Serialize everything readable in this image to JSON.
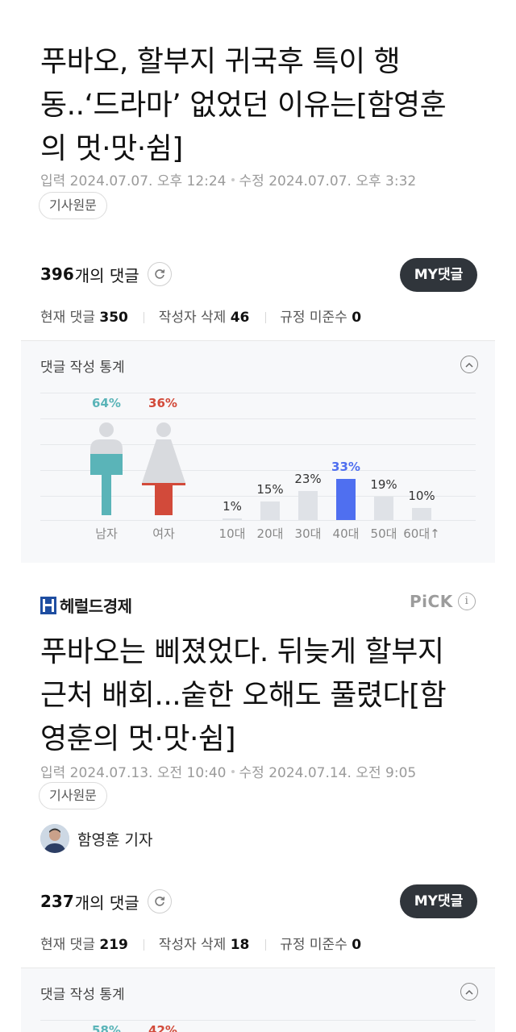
{
  "article1": {
    "title_lines": [
      "푸바오, 할부지 귀국후 특이 행",
      "동..‘드라마’ 없었던 이유는[함영훈",
      "의 멋·맛·쉼]"
    ],
    "input_date": "입력 2024.07.07. 오후 12:24",
    "edit_date": "수정 2024.07.07. 오후 3:32",
    "original_chip": "기사원문",
    "comments": {
      "count": "396",
      "count_label": "개의 댓글",
      "my_button": "MY댓글",
      "current_label": "현재 댓글",
      "current_value": "350",
      "deleted_label": "작성자 삭제",
      "deleted_value": "46",
      "violation_label": "규정 미준수",
      "violation_value": "0"
    },
    "stats": {
      "title": "댓글 작성 통계",
      "male_pct": "64%",
      "female_pct": "36%",
      "male_label": "남자",
      "female_label": "여자",
      "ages": [
        {
          "label": "10대",
          "pct": "1%",
          "value": 1
        },
        {
          "label": "20대",
          "pct": "15%",
          "value": 15
        },
        {
          "label": "30대",
          "pct": "23%",
          "value": 23
        },
        {
          "label": "40대",
          "pct": "33%",
          "value": 33
        },
        {
          "label": "50대",
          "pct": "19%",
          "value": 19
        },
        {
          "label": "60대↑",
          "pct": "10%",
          "value": 10
        }
      ]
    }
  },
  "press": {
    "logo_text": "헤럴드경제",
    "pick_label": "PiCK",
    "info_glyph": "i"
  },
  "article2": {
    "title_lines": [
      "푸바오는 삐졌었다. 뒤늦게 할부지",
      "근처 배회...숱한 오해도 풀렸다[함",
      "영훈의 멋·맛·쉼]"
    ],
    "input_date": "입력 2024.07.13. 오전 10:40",
    "edit_date": "수정 2024.07.14. 오전 9:05",
    "original_chip": "기사원문",
    "reporter": "함영훈 기자",
    "comments": {
      "count": "237",
      "count_label": "개의 댓글",
      "my_button": "MY댓글",
      "current_label": "현재 댓글",
      "current_value": "219",
      "deleted_label": "작성자 삭제",
      "deleted_value": "18",
      "violation_label": "규정 미준수",
      "violation_value": "0"
    },
    "stats": {
      "title": "댓글 작성 통계",
      "male_pct": "58%",
      "female_pct": "42%"
    }
  },
  "colors": {
    "male": "#5ab4b8",
    "female": "#d24a3a",
    "highlight_bar": "#4f6ff0",
    "bar": "#dfe2e7",
    "button_dark": "#30353b"
  },
  "chart_data": [
    {
      "type": "bar",
      "title": "댓글 작성 통계",
      "categories": [
        "남자",
        "여자"
      ],
      "values": [
        64,
        42
      ],
      "note": "gender share of article 1 comments",
      "series": [
        {
          "values": [
            64,
            36
          ]
        }
      ]
    },
    {
      "type": "bar",
      "title": "댓글 작성 통계",
      "categories": [
        "10대",
        "20대",
        "30대",
        "40대",
        "50대",
        "60대↑"
      ],
      "values": [
        1,
        15,
        23,
        33,
        19,
        10
      ]
    }
  ]
}
